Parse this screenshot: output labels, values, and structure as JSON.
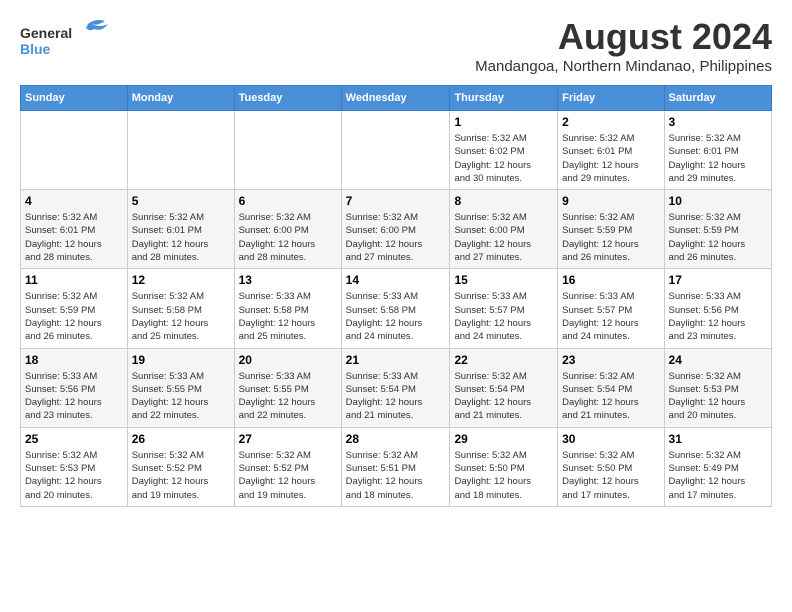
{
  "header": {
    "logo_line1": "General",
    "logo_line2": "Blue",
    "month_year": "August 2024",
    "location": "Mandangoa, Northern Mindanao, Philippines"
  },
  "weekdays": [
    "Sunday",
    "Monday",
    "Tuesday",
    "Wednesday",
    "Thursday",
    "Friday",
    "Saturday"
  ],
  "weeks": [
    [
      {
        "day": "",
        "info": ""
      },
      {
        "day": "",
        "info": ""
      },
      {
        "day": "",
        "info": ""
      },
      {
        "day": "",
        "info": ""
      },
      {
        "day": "1",
        "info": "Sunrise: 5:32 AM\nSunset: 6:02 PM\nDaylight: 12 hours\nand 30 minutes."
      },
      {
        "day": "2",
        "info": "Sunrise: 5:32 AM\nSunset: 6:01 PM\nDaylight: 12 hours\nand 29 minutes."
      },
      {
        "day": "3",
        "info": "Sunrise: 5:32 AM\nSunset: 6:01 PM\nDaylight: 12 hours\nand 29 minutes."
      }
    ],
    [
      {
        "day": "4",
        "info": "Sunrise: 5:32 AM\nSunset: 6:01 PM\nDaylight: 12 hours\nand 28 minutes."
      },
      {
        "day": "5",
        "info": "Sunrise: 5:32 AM\nSunset: 6:01 PM\nDaylight: 12 hours\nand 28 minutes."
      },
      {
        "day": "6",
        "info": "Sunrise: 5:32 AM\nSunset: 6:00 PM\nDaylight: 12 hours\nand 28 minutes."
      },
      {
        "day": "7",
        "info": "Sunrise: 5:32 AM\nSunset: 6:00 PM\nDaylight: 12 hours\nand 27 minutes."
      },
      {
        "day": "8",
        "info": "Sunrise: 5:32 AM\nSunset: 6:00 PM\nDaylight: 12 hours\nand 27 minutes."
      },
      {
        "day": "9",
        "info": "Sunrise: 5:32 AM\nSunset: 5:59 PM\nDaylight: 12 hours\nand 26 minutes."
      },
      {
        "day": "10",
        "info": "Sunrise: 5:32 AM\nSunset: 5:59 PM\nDaylight: 12 hours\nand 26 minutes."
      }
    ],
    [
      {
        "day": "11",
        "info": "Sunrise: 5:32 AM\nSunset: 5:59 PM\nDaylight: 12 hours\nand 26 minutes."
      },
      {
        "day": "12",
        "info": "Sunrise: 5:32 AM\nSunset: 5:58 PM\nDaylight: 12 hours\nand 25 minutes."
      },
      {
        "day": "13",
        "info": "Sunrise: 5:33 AM\nSunset: 5:58 PM\nDaylight: 12 hours\nand 25 minutes."
      },
      {
        "day": "14",
        "info": "Sunrise: 5:33 AM\nSunset: 5:58 PM\nDaylight: 12 hours\nand 24 minutes."
      },
      {
        "day": "15",
        "info": "Sunrise: 5:33 AM\nSunset: 5:57 PM\nDaylight: 12 hours\nand 24 minutes."
      },
      {
        "day": "16",
        "info": "Sunrise: 5:33 AM\nSunset: 5:57 PM\nDaylight: 12 hours\nand 24 minutes."
      },
      {
        "day": "17",
        "info": "Sunrise: 5:33 AM\nSunset: 5:56 PM\nDaylight: 12 hours\nand 23 minutes."
      }
    ],
    [
      {
        "day": "18",
        "info": "Sunrise: 5:33 AM\nSunset: 5:56 PM\nDaylight: 12 hours\nand 23 minutes."
      },
      {
        "day": "19",
        "info": "Sunrise: 5:33 AM\nSunset: 5:55 PM\nDaylight: 12 hours\nand 22 minutes."
      },
      {
        "day": "20",
        "info": "Sunrise: 5:33 AM\nSunset: 5:55 PM\nDaylight: 12 hours\nand 22 minutes."
      },
      {
        "day": "21",
        "info": "Sunrise: 5:33 AM\nSunset: 5:54 PM\nDaylight: 12 hours\nand 21 minutes."
      },
      {
        "day": "22",
        "info": "Sunrise: 5:32 AM\nSunset: 5:54 PM\nDaylight: 12 hours\nand 21 minutes."
      },
      {
        "day": "23",
        "info": "Sunrise: 5:32 AM\nSunset: 5:54 PM\nDaylight: 12 hours\nand 21 minutes."
      },
      {
        "day": "24",
        "info": "Sunrise: 5:32 AM\nSunset: 5:53 PM\nDaylight: 12 hours\nand 20 minutes."
      }
    ],
    [
      {
        "day": "25",
        "info": "Sunrise: 5:32 AM\nSunset: 5:53 PM\nDaylight: 12 hours\nand 20 minutes."
      },
      {
        "day": "26",
        "info": "Sunrise: 5:32 AM\nSunset: 5:52 PM\nDaylight: 12 hours\nand 19 minutes."
      },
      {
        "day": "27",
        "info": "Sunrise: 5:32 AM\nSunset: 5:52 PM\nDaylight: 12 hours\nand 19 minutes."
      },
      {
        "day": "28",
        "info": "Sunrise: 5:32 AM\nSunset: 5:51 PM\nDaylight: 12 hours\nand 18 minutes."
      },
      {
        "day": "29",
        "info": "Sunrise: 5:32 AM\nSunset: 5:50 PM\nDaylight: 12 hours\nand 18 minutes."
      },
      {
        "day": "30",
        "info": "Sunrise: 5:32 AM\nSunset: 5:50 PM\nDaylight: 12 hours\nand 17 minutes."
      },
      {
        "day": "31",
        "info": "Sunrise: 5:32 AM\nSunset: 5:49 PM\nDaylight: 12 hours\nand 17 minutes."
      }
    ]
  ]
}
